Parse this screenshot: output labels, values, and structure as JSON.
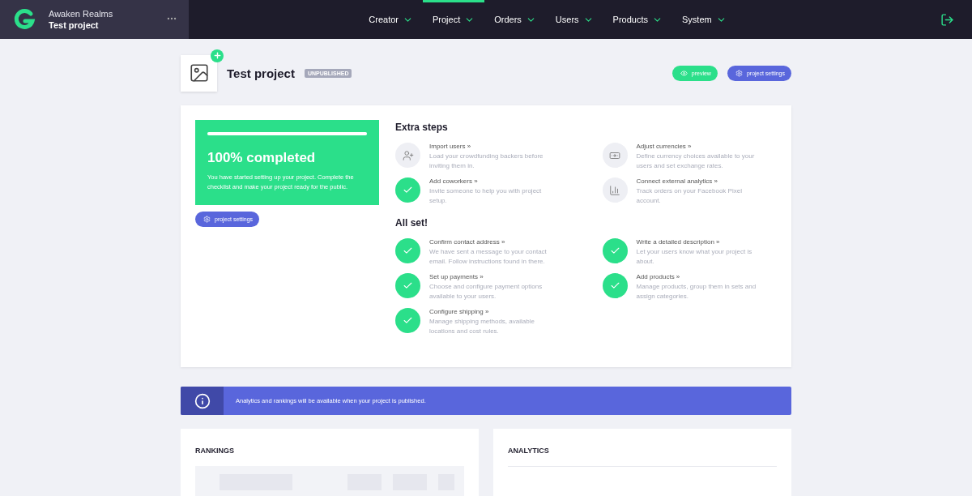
{
  "brand": {
    "company": "Awaken Realms",
    "project": "Test project"
  },
  "nav": [
    {
      "label": "Creator",
      "selected": false
    },
    {
      "label": "Project",
      "selected": true
    },
    {
      "label": "Orders",
      "selected": false
    },
    {
      "label": "Users",
      "selected": false
    },
    {
      "label": "Products",
      "selected": false
    },
    {
      "label": "System",
      "selected": false
    }
  ],
  "header": {
    "title": "Test project",
    "status": "UNPUBLISHED",
    "preview": "preview",
    "settings": "project settings"
  },
  "progress": {
    "level": 1,
    "title": "100% completed",
    "text": "You have started setting up your project. Complete the checklist and make your project ready for the public.",
    "button": "project settings"
  },
  "sections": [
    {
      "title": "Extra steps",
      "steps": [
        {
          "title": "Import users »",
          "text": "Load your crowdfunding backers before inviting them in.",
          "done": false
        },
        {
          "title": "Adjust currencies »",
          "text": "Define currency choices available to your users and set exchange rates.",
          "done": false
        },
        {
          "title": "Add coworkers »",
          "text": "Invite someone to help you with project setup.",
          "done": true
        },
        {
          "title": "Connect external analytics »",
          "text": "Track orders on your Facebook Pixel account.",
          "done": false
        }
      ]
    },
    {
      "title": "All set!",
      "steps": [
        {
          "title": "Confirm contact address »",
          "text": "We have sent a message to your contact email. Follow instructions found in there.",
          "done": true
        },
        {
          "title": "Write a detailed description »",
          "text": "Let your users know what your project is about.",
          "done": true
        },
        {
          "title": "Set up payments »",
          "text": "Choose and configure payment options available to your users.",
          "done": true
        },
        {
          "title": "Add products »",
          "text": "Manage products, group them in sets and assign categories.",
          "done": true
        },
        {
          "title": "Configure shipping »",
          "text": "Manage shipping methods, available locations and cost rules.",
          "done": true
        }
      ]
    }
  ],
  "notice": "Analytics and rankings will be available when your project is published.",
  "rankings": {
    "title": "RANKINGS"
  },
  "analytics": {
    "title": "ANALYTICS"
  }
}
